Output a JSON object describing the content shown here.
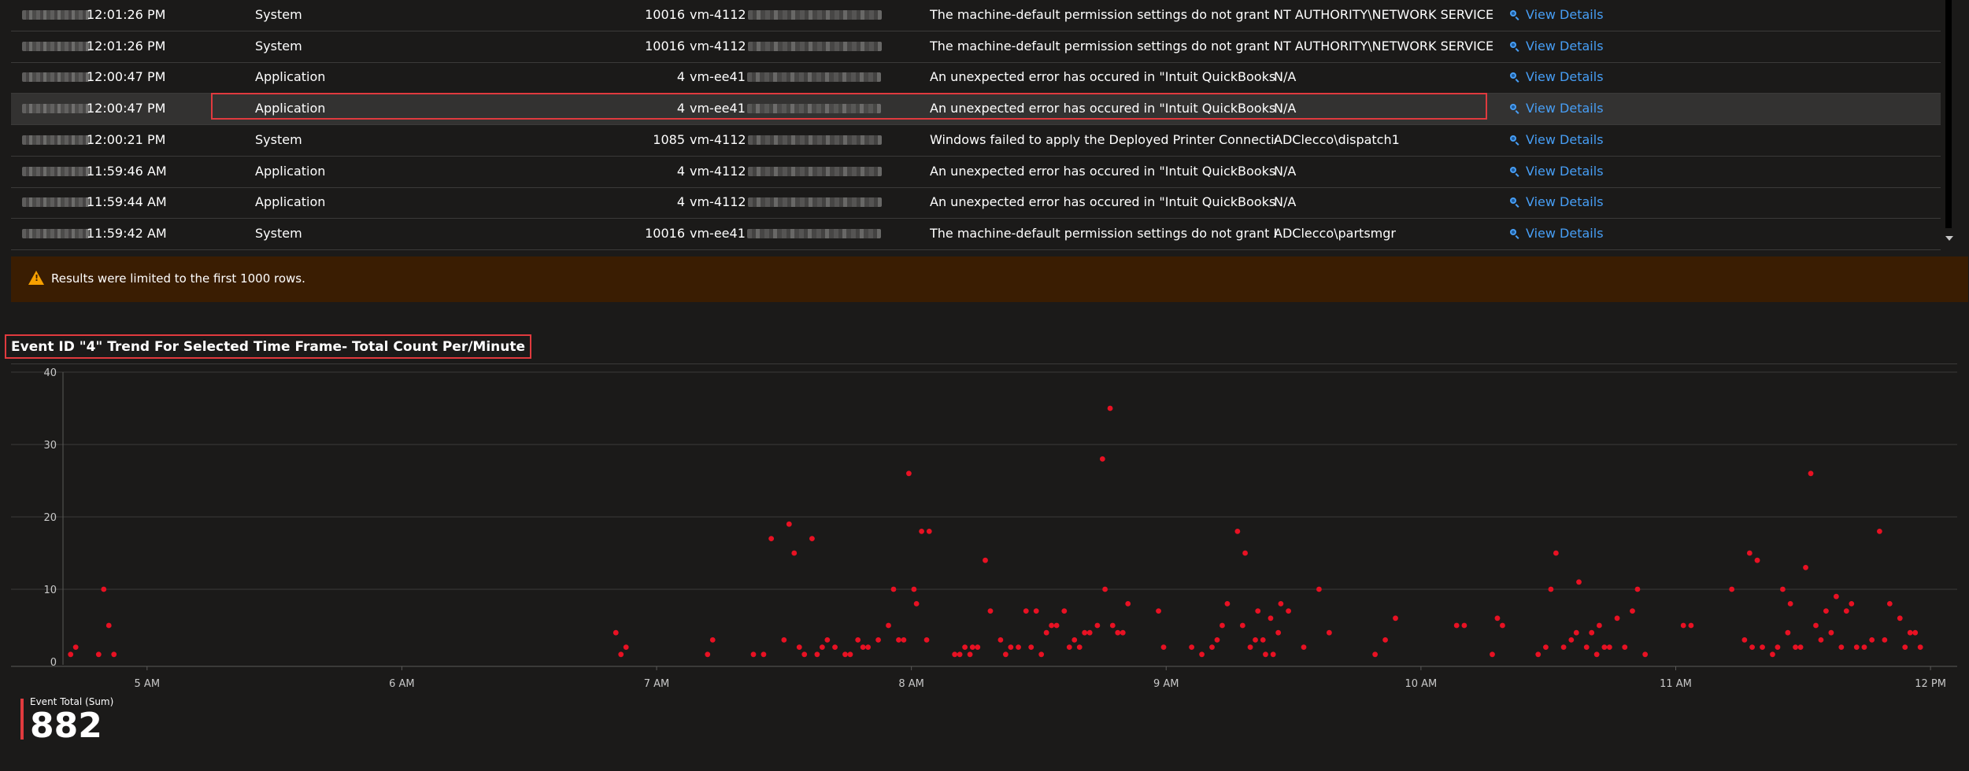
{
  "table": {
    "rows": [
      {
        "time": "12:01:26 PM",
        "log": "System",
        "event_id": "10016",
        "computer_prefix": "vm-4112",
        "message": "The machine-default permission settings do not grant Lo...",
        "user": "NT AUTHORITY\\NETWORK SERVICE",
        "link": "View Details",
        "selected": false
      },
      {
        "time": "12:01:26 PM",
        "log": "System",
        "event_id": "10016",
        "computer_prefix": "vm-4112",
        "message": "The machine-default permission settings do not grant Lo...",
        "user": "NT AUTHORITY\\NETWORK SERVICE",
        "link": "View Details",
        "selected": false
      },
      {
        "time": "12:00:47 PM",
        "log": "Application",
        "event_id": "4",
        "computer_prefix": "vm-ee41",
        "message": "An unexpected error has occured in \"Intuit QuickBooks E...",
        "user": "N/A",
        "link": "View Details",
        "selected": false
      },
      {
        "time": "12:00:47 PM",
        "log": "Application",
        "event_id": "4",
        "computer_prefix": "vm-ee41",
        "message": "An unexpected error has occured in \"Intuit QuickBooks E...",
        "user": "N/A",
        "link": "View Details",
        "selected": true
      },
      {
        "time": "12:00:21 PM",
        "log": "System",
        "event_id": "1085",
        "computer_prefix": "vm-4112",
        "message": "Windows failed to apply the Deployed Printer Connection...",
        "user": "ADClecco\\dispatch1",
        "link": "View Details",
        "selected": false
      },
      {
        "time": "11:59:46 AM",
        "log": "Application",
        "event_id": "4",
        "computer_prefix": "vm-4112",
        "message": "An unexpected error has occured in \"Intuit QuickBooks E...",
        "user": "N/A",
        "link": "View Details",
        "selected": false
      },
      {
        "time": "11:59:44 AM",
        "log": "Application",
        "event_id": "4",
        "computer_prefix": "vm-4112",
        "message": "An unexpected error has occured in \"Intuit QuickBooks E...",
        "user": "N/A",
        "link": "View Details",
        "selected": false
      },
      {
        "time": "11:59:42 AM",
        "log": "System",
        "event_id": "10016",
        "computer_prefix": "vm-ee41",
        "message": "The machine-default permission settings do not grant Lo...",
        "user": "ADClecco\\partsmgr",
        "link": "View Details",
        "selected": false
      }
    ]
  },
  "warning": {
    "text": "Results were limited to the first 1000 rows.",
    "icon": "warning-triangle-icon",
    "color": "#f7a000"
  },
  "kpi": {
    "label": "Event Total (Sum)",
    "value": "882",
    "accent": "#e03a3e"
  },
  "colors": {
    "accent": "#e03a3e",
    "link": "#479ef5",
    "point": "#e81123"
  },
  "chart_data": {
    "type": "scatter",
    "title": "Event ID \"4\" Trend For Selected Time Frame- Total Count Per/Minute",
    "xlabel": "",
    "ylabel": "",
    "x_ticks": [
      "5 AM",
      "6 AM",
      "7 AM",
      "8 AM",
      "9 AM",
      "10 AM",
      "11 AM",
      "12 PM"
    ],
    "y_ticks": [
      0,
      10,
      20,
      30,
      40
    ],
    "ylim": [
      0,
      40
    ],
    "xlim_hours": [
      4.67,
      12.08
    ],
    "grid": true,
    "points_hour_value": [
      [
        4.7,
        1
      ],
      [
        4.72,
        2
      ],
      [
        4.81,
        1
      ],
      [
        4.83,
        10
      ],
      [
        4.85,
        5
      ],
      [
        4.87,
        1
      ],
      [
        6.84,
        4
      ],
      [
        6.86,
        1
      ],
      [
        6.88,
        2
      ],
      [
        7.2,
        1
      ],
      [
        7.22,
        3
      ],
      [
        7.38,
        1
      ],
      [
        7.42,
        1
      ],
      [
        7.45,
        17
      ],
      [
        7.5,
        3
      ],
      [
        7.52,
        19
      ],
      [
        7.54,
        15
      ],
      [
        7.56,
        2
      ],
      [
        7.58,
        1
      ],
      [
        7.61,
        17
      ],
      [
        7.63,
        1
      ],
      [
        7.65,
        2
      ],
      [
        7.67,
        3
      ],
      [
        7.7,
        2
      ],
      [
        7.74,
        1
      ],
      [
        7.76,
        1
      ],
      [
        7.79,
        3
      ],
      [
        7.81,
        2
      ],
      [
        7.83,
        2
      ],
      [
        7.87,
        3
      ],
      [
        7.91,
        5
      ],
      [
        7.93,
        10
      ],
      [
        7.95,
        3
      ],
      [
        7.97,
        3
      ],
      [
        7.99,
        26
      ],
      [
        8.01,
        10
      ],
      [
        8.02,
        8
      ],
      [
        8.04,
        18
      ],
      [
        8.06,
        3
      ],
      [
        8.07,
        18
      ],
      [
        8.17,
        1
      ],
      [
        8.19,
        1
      ],
      [
        8.21,
        2
      ],
      [
        8.23,
        1
      ],
      [
        8.24,
        2
      ],
      [
        8.26,
        2
      ],
      [
        8.29,
        14
      ],
      [
        8.31,
        7
      ],
      [
        8.35,
        3
      ],
      [
        8.37,
        1
      ],
      [
        8.39,
        2
      ],
      [
        8.42,
        2
      ],
      [
        8.45,
        7
      ],
      [
        8.47,
        2
      ],
      [
        8.49,
        7
      ],
      [
        8.51,
        1
      ],
      [
        8.53,
        4
      ],
      [
        8.55,
        5
      ],
      [
        8.57,
        5
      ],
      [
        8.6,
        7
      ],
      [
        8.62,
        2
      ],
      [
        8.64,
        3
      ],
      [
        8.66,
        2
      ],
      [
        8.68,
        4
      ],
      [
        8.7,
        4
      ],
      [
        8.73,
        5
      ],
      [
        8.75,
        28
      ],
      [
        8.76,
        10
      ],
      [
        8.78,
        35
      ],
      [
        8.79,
        5
      ],
      [
        8.81,
        4
      ],
      [
        8.83,
        4
      ],
      [
        8.85,
        8
      ],
      [
        8.97,
        7
      ],
      [
        8.99,
        2
      ],
      [
        9.1,
        2
      ],
      [
        9.14,
        1
      ],
      [
        9.18,
        2
      ],
      [
        9.2,
        3
      ],
      [
        9.22,
        5
      ],
      [
        9.24,
        8
      ],
      [
        9.28,
        18
      ],
      [
        9.3,
        5
      ],
      [
        9.31,
        15
      ],
      [
        9.33,
        2
      ],
      [
        9.35,
        3
      ],
      [
        9.36,
        7
      ],
      [
        9.38,
        3
      ],
      [
        9.39,
        1
      ],
      [
        9.41,
        6
      ],
      [
        9.42,
        1
      ],
      [
        9.44,
        4
      ],
      [
        9.45,
        8
      ],
      [
        9.48,
        7
      ],
      [
        9.54,
        2
      ],
      [
        9.6,
        10
      ],
      [
        9.64,
        4
      ],
      [
        9.82,
        1
      ],
      [
        9.86,
        3
      ],
      [
        9.9,
        6
      ],
      [
        10.14,
        5
      ],
      [
        10.17,
        5
      ],
      [
        10.28,
        1
      ],
      [
        10.3,
        6
      ],
      [
        10.32,
        5
      ],
      [
        10.46,
        1
      ],
      [
        10.49,
        2
      ],
      [
        10.51,
        10
      ],
      [
        10.53,
        15
      ],
      [
        10.56,
        2
      ],
      [
        10.59,
        3
      ],
      [
        10.61,
        4
      ],
      [
        10.62,
        11
      ],
      [
        10.65,
        2
      ],
      [
        10.67,
        4
      ],
      [
        10.69,
        1
      ],
      [
        10.7,
        5
      ],
      [
        10.72,
        2
      ],
      [
        10.74,
        2
      ],
      [
        10.77,
        6
      ],
      [
        10.8,
        2
      ],
      [
        10.83,
        7
      ],
      [
        10.85,
        10
      ],
      [
        10.88,
        1
      ],
      [
        11.03,
        5
      ],
      [
        11.06,
        5
      ],
      [
        11.22,
        10
      ],
      [
        11.27,
        3
      ],
      [
        11.29,
        15
      ],
      [
        11.3,
        2
      ],
      [
        11.32,
        14
      ],
      [
        11.34,
        2
      ],
      [
        11.38,
        1
      ],
      [
        11.4,
        2
      ],
      [
        11.42,
        10
      ],
      [
        11.44,
        4
      ],
      [
        11.45,
        8
      ],
      [
        11.47,
        2
      ],
      [
        11.49,
        2
      ],
      [
        11.51,
        13
      ],
      [
        11.53,
        26
      ],
      [
        11.55,
        5
      ],
      [
        11.57,
        3
      ],
      [
        11.59,
        7
      ],
      [
        11.61,
        4
      ],
      [
        11.63,
        9
      ],
      [
        11.65,
        2
      ],
      [
        11.67,
        7
      ],
      [
        11.69,
        8
      ],
      [
        11.71,
        2
      ],
      [
        11.74,
        2
      ],
      [
        11.77,
        3
      ],
      [
        11.8,
        18
      ],
      [
        11.82,
        3
      ],
      [
        11.84,
        8
      ],
      [
        11.88,
        6
      ],
      [
        11.9,
        2
      ],
      [
        11.92,
        4
      ],
      [
        11.94,
        4
      ],
      [
        11.96,
        2
      ]
    ]
  }
}
